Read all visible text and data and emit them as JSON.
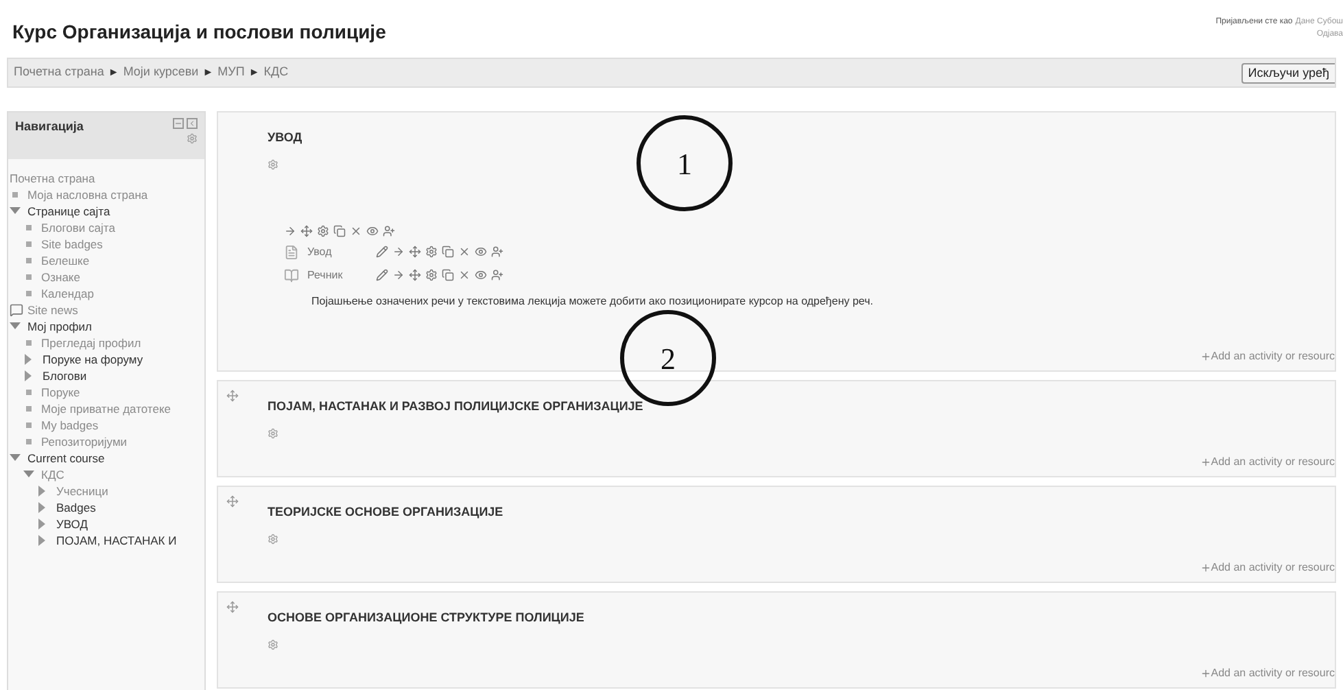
{
  "header": {
    "title": "Курс Организација и послови полиције",
    "login_text": "Пријављени сте као",
    "user_name": "Дане Субош",
    "logout": "Одјава"
  },
  "breadcrumb": [
    "Почетна страна",
    "Моји курсеви",
    "МУП",
    "КДС"
  ],
  "breadcrumb_separator": "►",
  "edit_button": "Искључи уређ",
  "navigation": {
    "title": "Навигација",
    "items": [
      {
        "kind": "plain",
        "label": "Почетна страна",
        "link": true
      },
      {
        "kind": "bullet",
        "label": "Моја насловна страна",
        "link": true
      },
      {
        "kind": "branch",
        "label": "Странице сајта",
        "link": false,
        "expanded": true,
        "children": [
          {
            "kind": "bullet",
            "label": "Блогови сајта",
            "link": true
          },
          {
            "kind": "bullet",
            "label": "Site badges",
            "link": true
          },
          {
            "kind": "bullet",
            "label": "Белешке",
            "link": true
          },
          {
            "kind": "bullet",
            "label": "Ознаке",
            "link": true
          },
          {
            "kind": "bullet",
            "label": "Календар",
            "link": true
          }
        ]
      },
      {
        "kind": "news",
        "label": "Site news",
        "link": true
      },
      {
        "kind": "branch",
        "label": "Мој профил",
        "link": false,
        "expanded": true,
        "children": [
          {
            "kind": "bullet",
            "label": "Прегледај профил",
            "link": true
          },
          {
            "kind": "branch",
            "label": "Поруке на форуму",
            "link": false,
            "expanded": false
          },
          {
            "kind": "branch",
            "label": "Блогови",
            "link": false,
            "expanded": false
          },
          {
            "kind": "bullet",
            "label": "Поруке",
            "link": true
          },
          {
            "kind": "bullet",
            "label": "Моје приватне датотеке",
            "link": true
          },
          {
            "kind": "bullet",
            "label": "My badges",
            "link": true
          },
          {
            "kind": "bullet",
            "label": "Репозиторијуми",
            "link": true
          }
        ]
      },
      {
        "kind": "branch",
        "label": "Current course",
        "link": false,
        "expanded": true,
        "children": [
          {
            "kind": "branch",
            "label": "КДС",
            "link": true,
            "expanded": true,
            "children": [
              {
                "kind": "branch",
                "label": "Учесници",
                "link": true,
                "expanded": false
              },
              {
                "kind": "branch",
                "label": "Badges",
                "link": false,
                "expanded": false
              },
              {
                "kind": "branch",
                "label": "УВОД",
                "link": false,
                "expanded": false
              },
              {
                "kind": "branch",
                "label": "ПОЈАМ, НАСТАНАК И",
                "link": false,
                "expanded": false
              }
            ]
          }
        ]
      }
    ]
  },
  "sections": [
    {
      "title": "УВОД",
      "movable": false,
      "activities": [
        {
          "kind": "page",
          "name": "Увод"
        },
        {
          "kind": "glossary",
          "name": "Речник"
        }
      ],
      "note": "Појашњење означених речи у текстовима лекција можете добити ако позиционирате курсор на одређену реч.",
      "add_link": "Add an activity or resourc"
    },
    {
      "title": "ПОЈАМ, НАСТАНАК И РАЗВОЈ ПОЛИЦИЈСКЕ ОРГАНИЗАЦИЈЕ",
      "movable": true,
      "add_link": "Add an activity or resourc"
    },
    {
      "title": "ТЕОРИЈСКЕ ОСНОВЕ ОРГАНИЗАЦИЈЕ",
      "movable": true,
      "add_link": "Add an activity or resourc"
    },
    {
      "title": "ОСНОВЕ ОРГАНИЗАЦИОНЕ СТРУКТУРЕ ПОЛИЦИЈЕ",
      "movable": true,
      "add_link": "Add an activity or resourc"
    }
  ],
  "callouts": [
    "1",
    "2"
  ]
}
